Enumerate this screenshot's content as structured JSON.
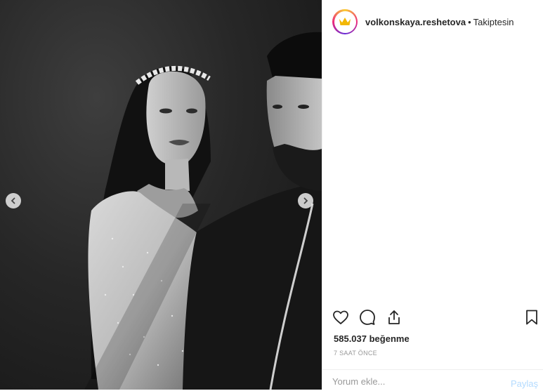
{
  "post": {
    "image": {
      "alt": "",
      "prev_icon": "chevron-left-icon",
      "next_icon": "chevron-right-icon"
    },
    "header": {
      "username": "volkonskaya.reshetova",
      "separator": "•",
      "follow_status": "Takiptesin",
      "avatar_icon": "crown-icon"
    },
    "actions": {
      "like_icon": "heart-icon",
      "comment_icon": "comment-icon",
      "share_icon": "share-icon",
      "save_icon": "bookmark-icon"
    },
    "likes": "585.037 beğenme",
    "timestamp": "7 SAAT ÖNCE",
    "comment": {
      "placeholder": "Yorum ekle...",
      "post_label": "Paylaş"
    }
  },
  "colors": {
    "text": "#262626",
    "muted": "#999999",
    "post_button_disabled": "#b3dbff",
    "crown": "#f2b705"
  }
}
